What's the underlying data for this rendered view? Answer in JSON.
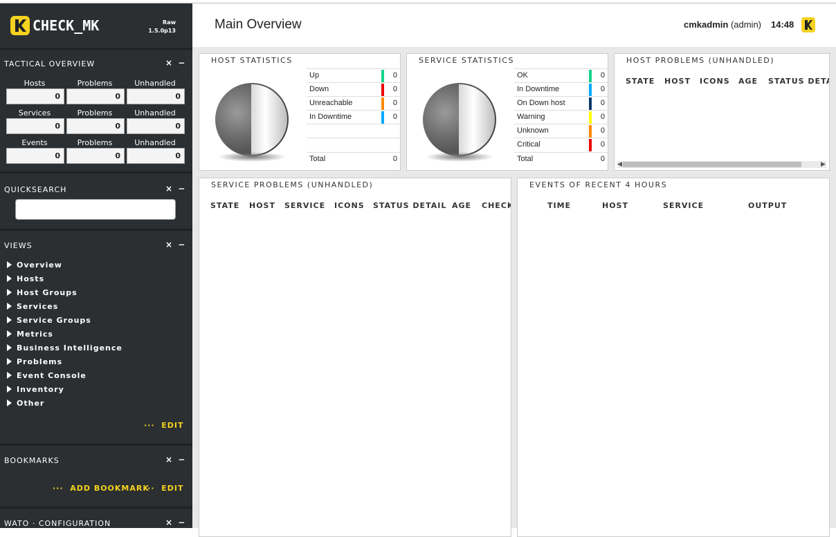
{
  "brand": {
    "logo_text": "CHECK_MK",
    "logo_letter": "K",
    "edition": "Raw",
    "version": "1.5.0p13"
  },
  "sidebar": {
    "tactical": {
      "title": "TACTICAL OVERVIEW",
      "rows": [
        {
          "labels": [
            "Hosts",
            "Problems",
            "Unhandled"
          ],
          "values": [
            "0",
            "0",
            "0"
          ]
        },
        {
          "labels": [
            "Services",
            "Problems",
            "Unhandled"
          ],
          "values": [
            "0",
            "0",
            "0"
          ]
        },
        {
          "labels": [
            "Events",
            "Problems",
            "Unhandled"
          ],
          "values": [
            "0",
            "0",
            "0"
          ]
        }
      ]
    },
    "quicksearch": {
      "title": "QUICKSEARCH",
      "value": ""
    },
    "views": {
      "title": "VIEWS",
      "items": [
        "Overview",
        "Hosts",
        "Host Groups",
        "Services",
        "Service Groups",
        "Metrics",
        "Business Intelligence",
        "Problems",
        "Event Console",
        "Inventory",
        "Other"
      ],
      "edit_label": "EDIT"
    },
    "bookmarks": {
      "title": "BOOKMARKS",
      "add_label": "ADD BOOKMARK",
      "edit_label": "EDIT"
    },
    "wato": {
      "title": "WATO · CONFIGURATION"
    },
    "controls": {
      "close": "×",
      "minimize": "−",
      "dots": "···"
    }
  },
  "header": {
    "title": "Main Overview",
    "user": "cmkadmin",
    "role": "(admin)",
    "time": "14:48"
  },
  "host_stats": {
    "title": "HOST STATISTICS",
    "rows": [
      {
        "label": "Up",
        "value": "0",
        "color": "#13d389"
      },
      {
        "label": "Down",
        "value": "0",
        "color": "#ee0000"
      },
      {
        "label": "Unreachable",
        "value": "0",
        "color": "#ff8800"
      },
      {
        "label": "In Downtime",
        "value": "0",
        "color": "#00aaff"
      }
    ],
    "total_label": "Total",
    "total_value": "0"
  },
  "service_stats": {
    "title": "SERVICE STATISTICS",
    "rows": [
      {
        "label": "OK",
        "value": "0",
        "color": "#13d389"
      },
      {
        "label": "In Downtime",
        "value": "0",
        "color": "#00aaff"
      },
      {
        "label": "On Down host",
        "value": "0",
        "color": "#0b3a6a"
      },
      {
        "label": "Warning",
        "value": "0",
        "color": "#ffff00"
      },
      {
        "label": "Unknown",
        "value": "0",
        "color": "#ff8800"
      },
      {
        "label": "Critical",
        "value": "0",
        "color": "#ee0000"
      }
    ],
    "total_label": "Total",
    "total_value": "0"
  },
  "host_problems": {
    "title": "HOST PROBLEMS (UNHANDLED)",
    "columns": [
      "STATE",
      "HOST",
      "ICONS",
      "AGE",
      "STATUS DETAIL"
    ]
  },
  "service_problems": {
    "title": "SERVICE PROBLEMS (UNHANDLED)",
    "columns": [
      "STATE",
      "HOST",
      "SERVICE",
      "ICONS",
      "STATUS DETAIL",
      "AGE",
      "CHECKED"
    ]
  },
  "events": {
    "title": "EVENTS OF RECENT 4 HOURS",
    "columns": [
      "TIME",
      "HOST",
      "SERVICE",
      "OUTPUT"
    ]
  }
}
